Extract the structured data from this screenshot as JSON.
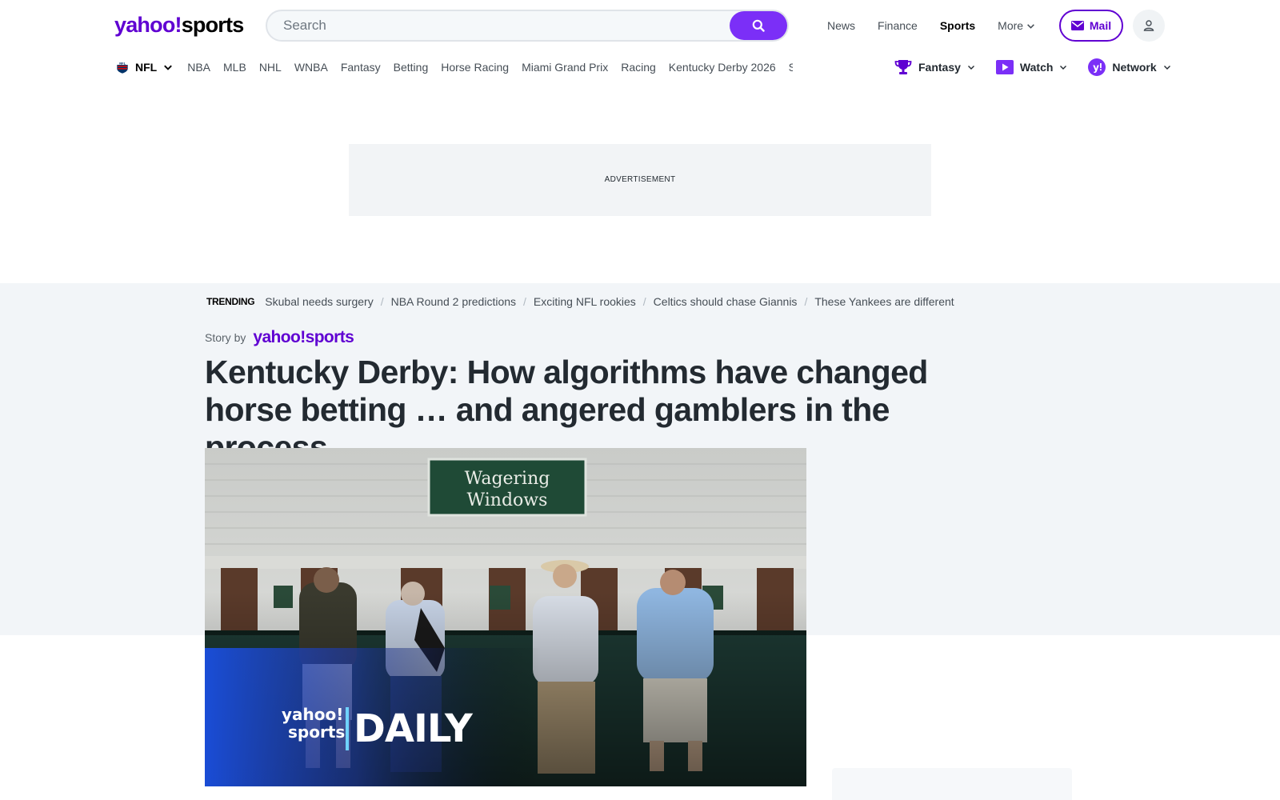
{
  "brand": {
    "name_yahoo": "yahoo!",
    "name_sports": "sports"
  },
  "search": {
    "placeholder": "Search"
  },
  "topnav": {
    "news": "News",
    "finance": "Finance",
    "sports": "Sports",
    "more": "More"
  },
  "mail": {
    "label": "Mail"
  },
  "subnav": {
    "nfl": "NFL",
    "items": [
      "NBA",
      "MLB",
      "NHL",
      "WNBA",
      "Fantasy",
      "Betting",
      "Horse Racing",
      "Miami Grand Prix",
      "Racing",
      "Kentucky Derby 2026",
      "S"
    ]
  },
  "rightnav": {
    "fantasy": "Fantasy",
    "watch": "Watch",
    "network": "Network"
  },
  "ad": {
    "label": "ADVERTISEMENT"
  },
  "trending": {
    "label": "TRENDING",
    "items": [
      "Skubal needs surgery",
      "NBA Round 2 predictions",
      "Exciting NFL rookies",
      "Celtics should chase Giannis",
      "These Yankees are different"
    ]
  },
  "story": {
    "by_label": "Story by",
    "source_yahoo": "yahoo!",
    "source_sports": "sports"
  },
  "headline": "Kentucky Derby: How algorithms have changed horse betting … and angered gamblers in the process",
  "hero": {
    "sign_line1": "Wagering",
    "sign_line2": "Windows",
    "overlay_brand_top": "yahoo!",
    "overlay_brand_bottom": "sports",
    "overlay_show": "DAILY"
  },
  "colors": {
    "accent": "#6001d2",
    "search_button": "#7b2ff7",
    "band": "#f2f5f8"
  }
}
